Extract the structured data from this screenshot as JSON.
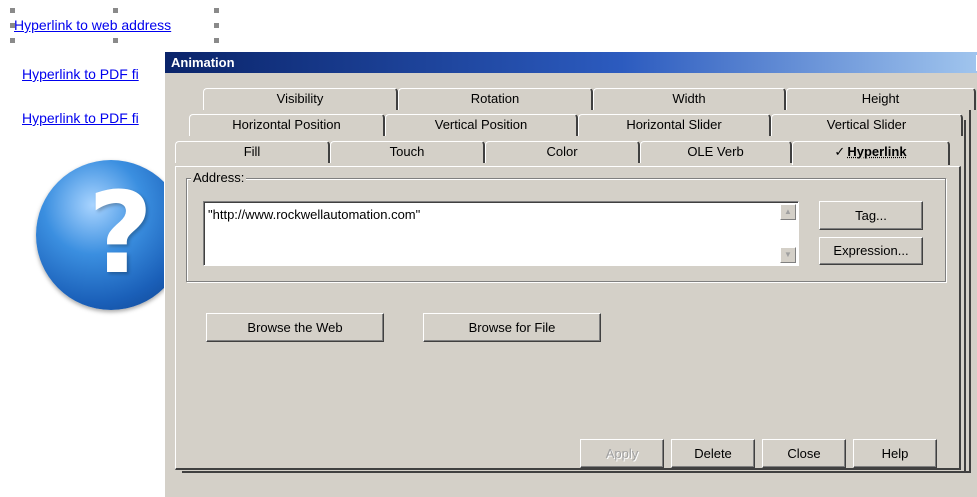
{
  "page": {
    "links": [
      "Hyperlink to web address",
      "Hyperlink to PDF fi",
      "Hyperlink to PDF fi"
    ],
    "help_icon": "question-mark-orb-icon"
  },
  "dialog": {
    "title": "Animation",
    "close_glyph": "×",
    "tabs_row1": [
      "Visibility",
      "Rotation",
      "Width",
      "Height"
    ],
    "tabs_row2": [
      "Horizontal Position",
      "Vertical Position",
      "Horizontal Slider",
      "Vertical Slider"
    ],
    "tabs_row3": [
      "Fill",
      "Touch",
      "Color",
      "OLE Verb"
    ],
    "active_tab": {
      "check": "✓",
      "label": "Hyperlink"
    },
    "address": {
      "group_label": "Address:",
      "value": "\"http://www.rockwellautomation.com\""
    },
    "buttons": {
      "tag": "Tag...",
      "expression": "Expression...",
      "browse_web": "Browse the Web",
      "browse_file": "Browse for File",
      "apply": "Apply",
      "delete": "Delete",
      "close": "Close",
      "help": "Help"
    }
  }
}
